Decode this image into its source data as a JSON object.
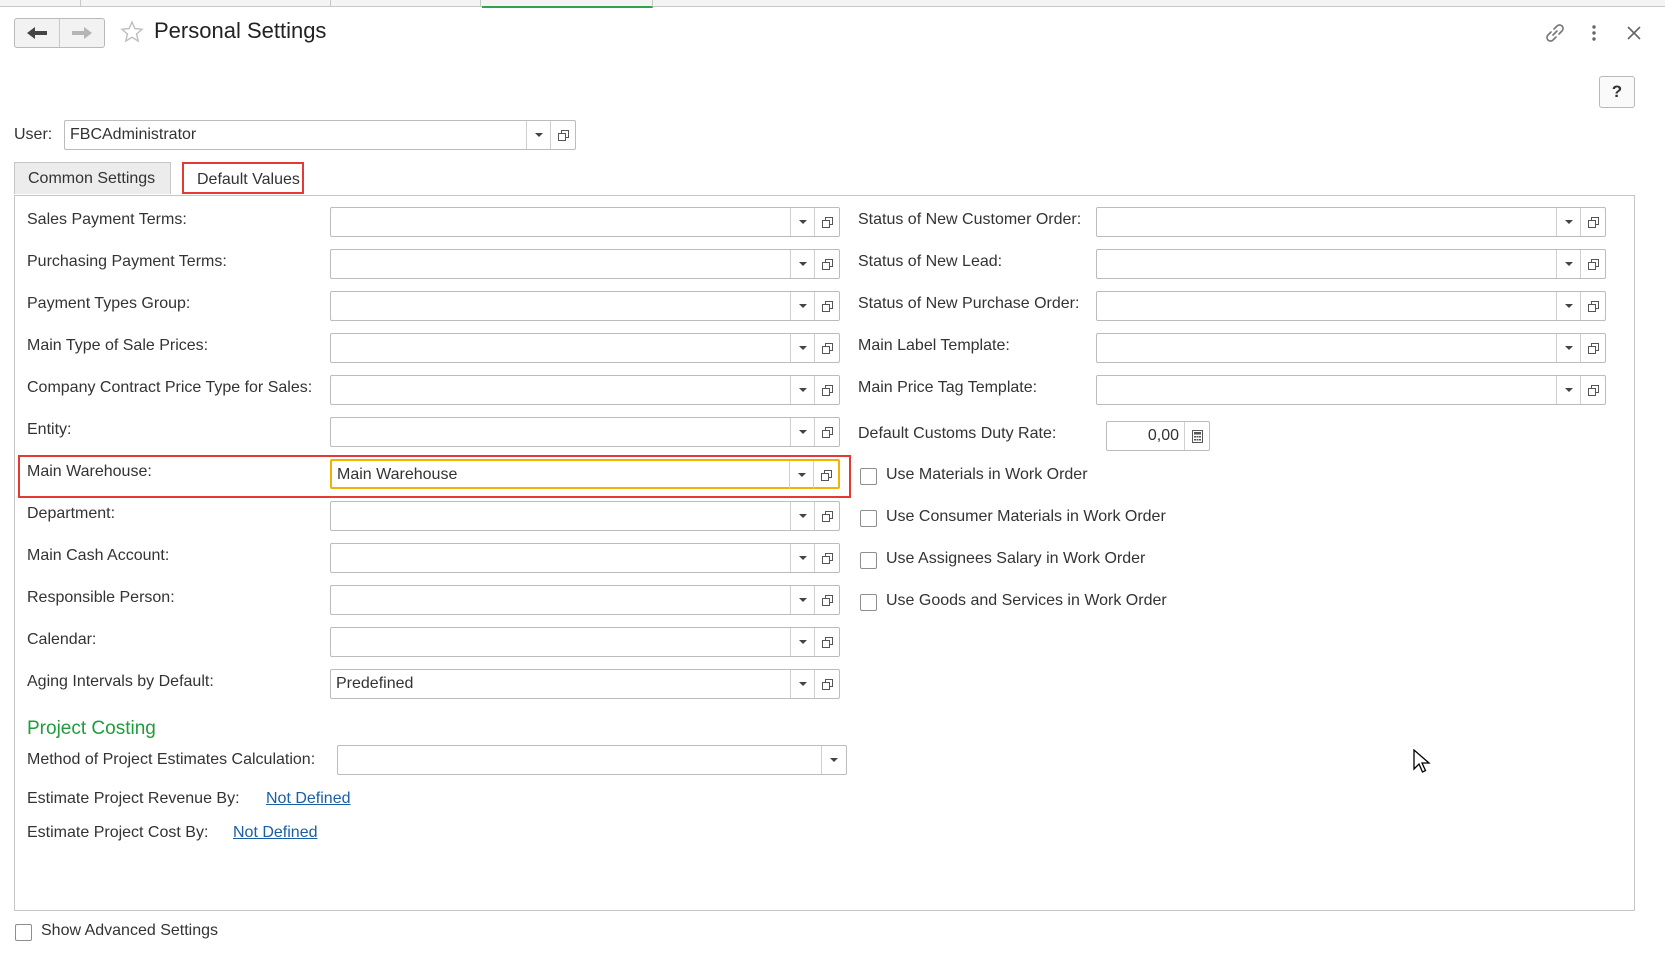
{
  "window": {
    "title": "Personal Settings"
  },
  "help": {
    "label": "?"
  },
  "user": {
    "label": "User:",
    "value": "FBCAdministrator"
  },
  "tabs": [
    {
      "label": "Common Settings"
    },
    {
      "label": "Default Values"
    }
  ],
  "left_fields": [
    {
      "label": "Sales Payment Terms:",
      "value": ""
    },
    {
      "label": "Purchasing Payment Terms:",
      "value": ""
    },
    {
      "label": "Payment Types Group:",
      "value": ""
    },
    {
      "label": "Main Type of Sale Prices:",
      "value": ""
    },
    {
      "label": "Company Contract Price Type for Sales:",
      "value": ""
    },
    {
      "label": "Entity:",
      "value": ""
    },
    {
      "label": "Main Warehouse:",
      "value": "Main Warehouse"
    },
    {
      "label": "Department:",
      "value": ""
    },
    {
      "label": "Main Cash Account:",
      "value": ""
    },
    {
      "label": "Responsible Person:",
      "value": ""
    },
    {
      "label": "Calendar:",
      "value": ""
    },
    {
      "label": "Aging Intervals by Default:",
      "value": "Predefined"
    }
  ],
  "right_fields": [
    {
      "label": "Status of New Customer Order:",
      "value": ""
    },
    {
      "label": "Status of New Lead:",
      "value": ""
    },
    {
      "label": "Status of New Purchase Order:",
      "value": ""
    },
    {
      "label": "Main Label Template:",
      "value": ""
    },
    {
      "label": "Main Price Tag Template:",
      "value": ""
    }
  ],
  "customs_duty": {
    "label": "Default Customs Duty Rate:",
    "value": "0,00"
  },
  "checkboxes": [
    {
      "label": "Use Materials in Work Order",
      "checked": false
    },
    {
      "label": "Use Consumer Materials in Work Order",
      "checked": false
    },
    {
      "label": "Use Assignees Salary in Work Order",
      "checked": false
    },
    {
      "label": "Use Goods and Services in Work Order",
      "checked": false
    }
  ],
  "project_costing": {
    "heading": "Project Costing",
    "method_label": "Method of Project Estimates Calculation:",
    "method_value": "",
    "revenue_label": "Estimate Project Revenue By:",
    "revenue_link": "Not Defined",
    "cost_label": "Estimate Project Cost By:",
    "cost_link": "Not Defined"
  },
  "advanced": {
    "label": "Show Advanced Settings",
    "checked": false
  },
  "colors": {
    "accent_green": "#1f9c3b",
    "highlight_red": "#e53935",
    "focus_yellow": "#f0b400",
    "link_blue": "#1a5ea8"
  },
  "icons": [
    "back-arrow-icon",
    "forward-arrow-icon",
    "star-icon",
    "link-icon",
    "more-vert-icon",
    "close-icon",
    "dropdown-icon",
    "open-icon",
    "calculator-icon",
    "cursor-icon"
  ]
}
